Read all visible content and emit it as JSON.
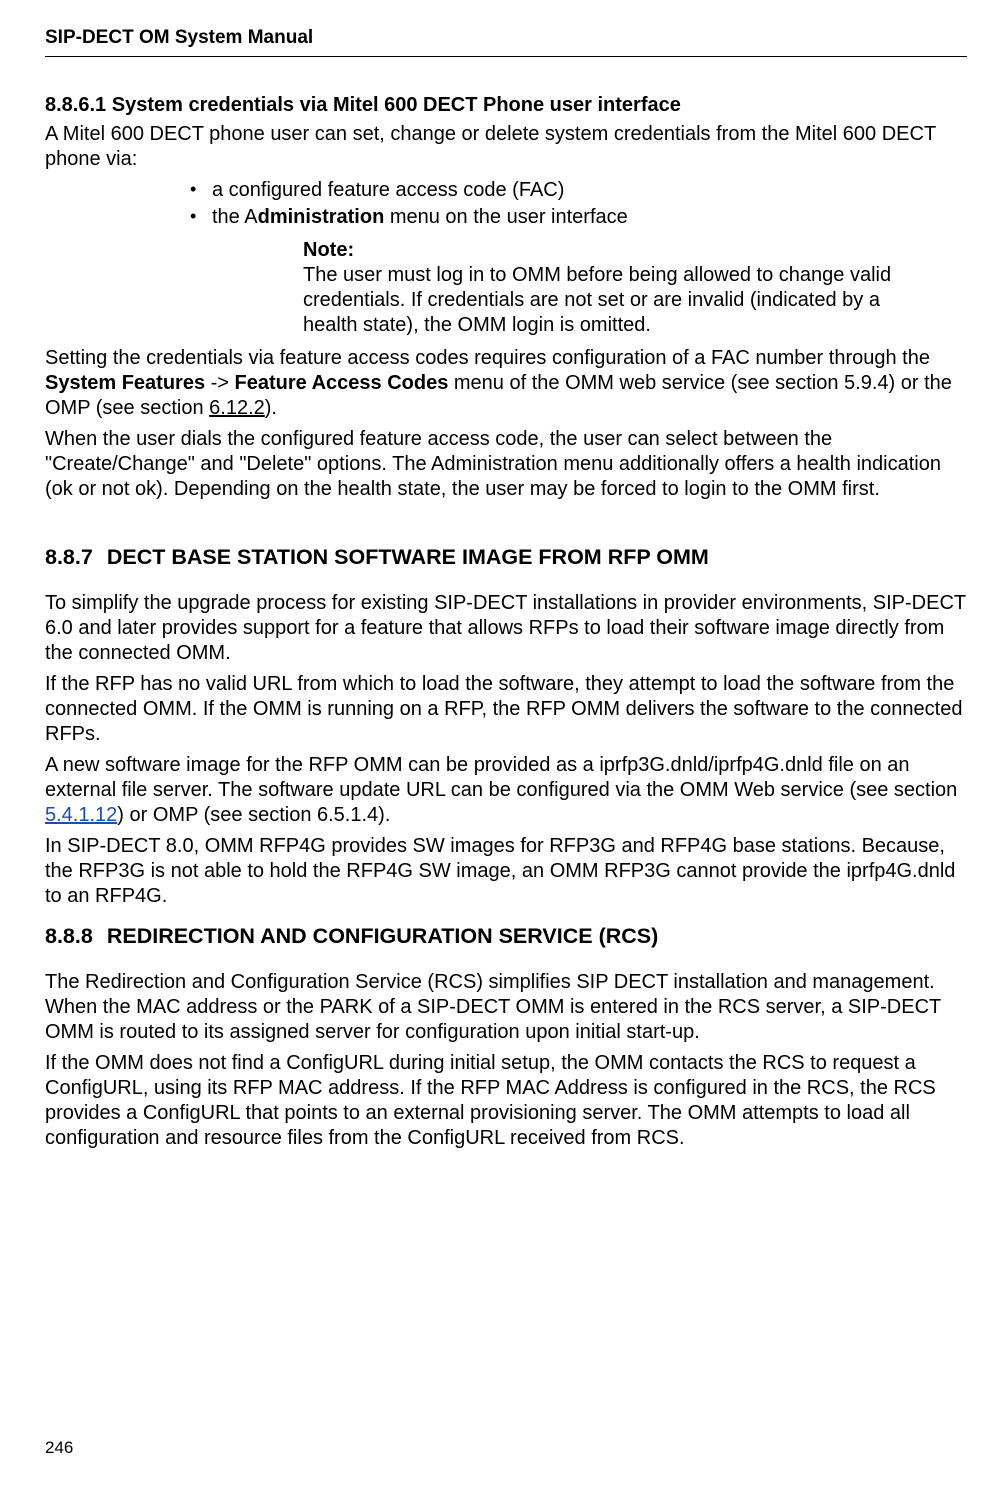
{
  "header": {
    "doc_title": "SIP-DECT OM System Manual"
  },
  "s1": {
    "num": "8.8.6.1",
    "title": "System credentials via Mitel 600 DECT Phone user interface",
    "intro": "A Mitel 600 DECT phone user can set, change or delete system credentials from the Mitel 600 DECT phone via:",
    "b1": "a configured feature access code (FAC)",
    "b2_pre": "the A",
    "b2_bold": "dministration",
    "b2_post": " menu on the user interface",
    "note_label": "Note:",
    "note_body": "The user must log in to OMM before being allowed to change valid credentials. If credentials are not set or are invalid (indicated by a health state), the OMM login is omitted.",
    "p2a": "Setting the credentials via feature access codes requires configuration of a FAC number through the ",
    "p2b": "System Features",
    "p2arrow": " -> ",
    "p2c": "Feature Access Codes",
    "p2d": " menu of the OMM web service (see section 5.9.4) or the OMP (see section ",
    "p2ref": "6.12.2",
    "p2e": ").",
    "p3": " When the user dials the configured feature access code, the user can select between the \"Create/Change\" and \"Delete\" options. The Administration menu additionally offers a health indication (ok or not ok). Depending on the health state, the user may be forced to login to the OMM first."
  },
  "s2": {
    "num": "8.8.7",
    "title": "DECT BASE STATION SOFTWARE IMAGE FROM RFP OMM",
    "p1": "To simplify the upgrade process for existing SIP-DECT installations in provider environments, SIP-DECT 6.0 and later provides support for a feature that allows RFPs to load their software image directly from the connected OMM.",
    "p2": "If the RFP has no valid URL from which to load the software, they attempt to load the software from the connected OMM. If the OMM is running on a RFP, the RFP OMM delivers the software to the connected RFPs.",
    "p3a": "A new software image for the RFP OMM can be provided as a iprfp3G.dnld/iprfp4G.dnld file on an external file server. The software update URL can be configured via the OMM Web service (see section ",
    "p3link": "5.4.1.12",
    "p3b": ") or OMP (see section 6.5.1.4).",
    "p4": "In SIP-DECT 8.0, OMM RFP4G provides SW images for RFP3G and RFP4G base stations. Because, the RFP3G is not able to hold the RFP4G SW image, an OMM RFP3G cannot provide the iprfp4G.dnld to an RFP4G."
  },
  "s3": {
    "num": "8.8.8",
    "title": "REDIRECTION AND CONFIGURATION SERVICE (RCS)",
    "p1": "The Redirection and Configuration Service (RCS) simplifies SIP DECT installation and management. When the MAC address or the PARK of a SIP-DECT OMM is entered in the RCS server, a SIP-DECT OMM is routed to its assigned server for configuration upon initial start-up.",
    "p2": "If the OMM does not find a ConfigURL during initial setup, the OMM contacts the RCS to request a ConfigURL, using its RFP MAC address. If the RFP MAC Address is configured in the RCS, the RCS provides a ConfigURL that points to an external provisioning server. The OMM attempts to load all configuration and resource files from the ConfigURL received from RCS."
  },
  "footer": {
    "page": "246"
  }
}
